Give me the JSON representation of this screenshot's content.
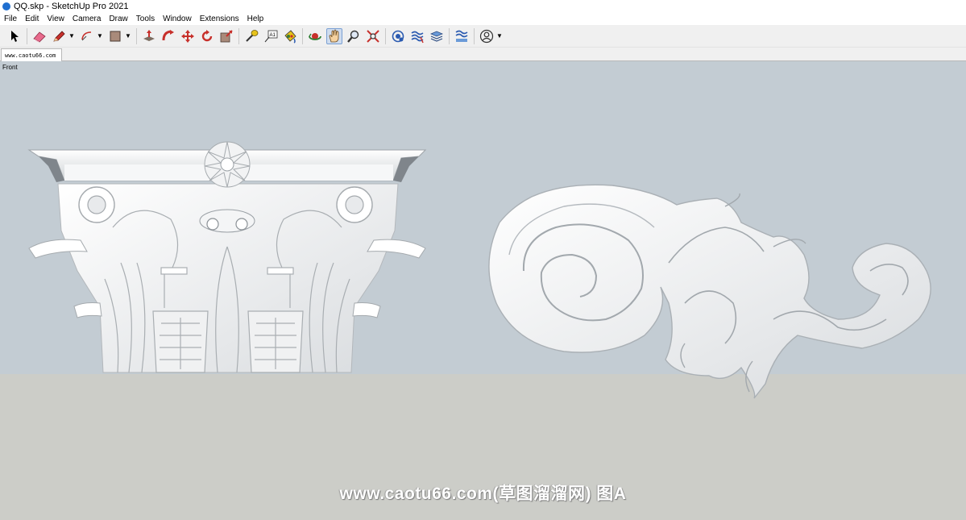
{
  "window": {
    "title": "QQ.skp - SketchUp Pro 2021"
  },
  "menu": [
    "File",
    "Edit",
    "View",
    "Camera",
    "Draw",
    "Tools",
    "Window",
    "Extensions",
    "Help"
  ],
  "toolbar": {
    "tools": [
      "select",
      "eraser",
      "pencil",
      "arc",
      "rectangle",
      "push-pull",
      "follow-me",
      "move",
      "rotate",
      "scale",
      "tape-measure",
      "text",
      "paint-bucket",
      "orbit",
      "pan",
      "zoom",
      "zoom-extents",
      "geo-location",
      "sandbox",
      "layers",
      "styles",
      "account"
    ],
    "active_tool": "pan"
  },
  "tabs": [
    {
      "label": "www.caotu66.com"
    }
  ],
  "viewport": {
    "scene_label": "Front",
    "watermark": "www.caotu66.com(草图溜溜网) 图A",
    "colors": {
      "sky": "#c3ccd3",
      "ground": "#cccdc8",
      "model": "#f2f2f2"
    },
    "objects": [
      "corinthian-capital",
      "acanthus-scroll-ornament"
    ]
  }
}
